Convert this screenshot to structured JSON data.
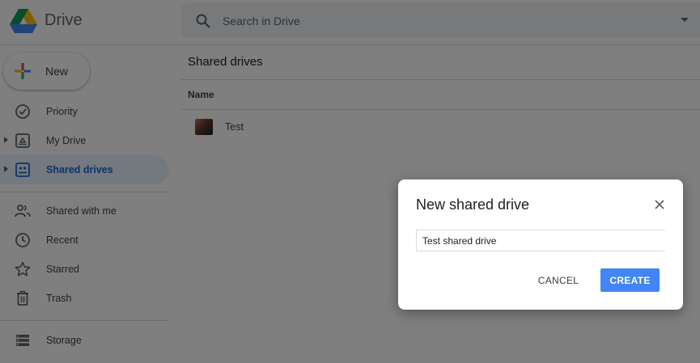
{
  "app": {
    "name": "Drive"
  },
  "search": {
    "placeholder": "Search in Drive"
  },
  "new_button": {
    "label": "New"
  },
  "sidebar": {
    "items": [
      {
        "label": "Priority",
        "icon": "priority-icon"
      },
      {
        "label": "My Drive",
        "icon": "my-drive-icon"
      },
      {
        "label": "Shared drives",
        "icon": "shared-drives-icon",
        "active": true
      },
      {
        "label": "Shared with me",
        "icon": "shared-with-me-icon"
      },
      {
        "label": "Recent",
        "icon": "clock-icon"
      },
      {
        "label": "Starred",
        "icon": "star-icon"
      },
      {
        "label": "Trash",
        "icon": "trash-icon"
      },
      {
        "label": "Storage",
        "icon": "storage-icon"
      }
    ]
  },
  "main": {
    "title": "Shared drives",
    "column_header": "Name",
    "drives": [
      {
        "name": "Test"
      }
    ]
  },
  "dialog": {
    "title": "New shared drive",
    "input_value": "Test shared drive",
    "cancel_label": "CANCEL",
    "create_label": "CREATE"
  },
  "colors": {
    "accent": "#4285f4",
    "active_bg": "#e8f0fe",
    "active_text": "#1967d2"
  }
}
